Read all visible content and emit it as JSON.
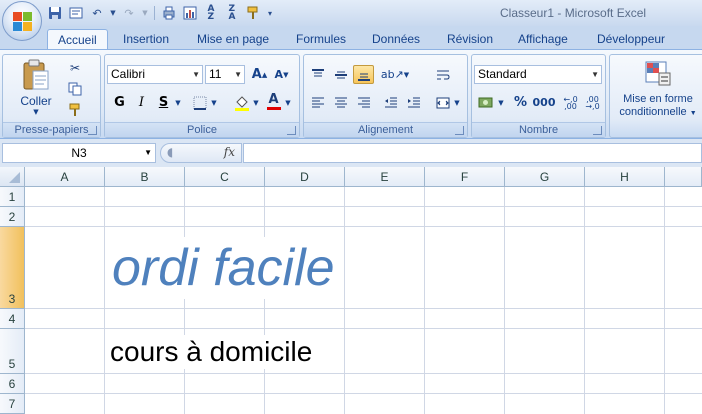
{
  "window": {
    "title": "Classeur1 - Microsoft Excel"
  },
  "tabs": [
    "Accueil",
    "Insertion",
    "Mise en page",
    "Formules",
    "Données",
    "Révision",
    "Affichage",
    "Développeur"
  ],
  "ribbon": {
    "clipboard": {
      "label": "Presse-papiers",
      "paste": "Coller"
    },
    "font": {
      "label": "Police",
      "name": "Calibri",
      "size": "11",
      "bold": "G",
      "italic": "I",
      "underline": "S",
      "font_color_letter": "A"
    },
    "alignment": {
      "label": "Alignement"
    },
    "number": {
      "label": "Nombre",
      "format": "Standard",
      "percent": "%",
      "thousands": "000"
    },
    "styles": {
      "conditional_line1": "Mise en forme",
      "conditional_line2": "conditionnelle"
    }
  },
  "formula_bar": {
    "name_box": "N3",
    "fx": "fx",
    "value": ""
  },
  "sheet": {
    "columns": [
      "A",
      "B",
      "C",
      "D",
      "E",
      "F",
      "G",
      "H"
    ],
    "rows": [
      "1",
      "2",
      "3",
      "4",
      "5",
      "6",
      "7"
    ],
    "selected_row": "3",
    "cells": {
      "B3": {
        "text": "ordi facile",
        "color": "#4f81bd"
      },
      "B5": {
        "text": "cours à domicile",
        "color": "#000000"
      }
    }
  }
}
